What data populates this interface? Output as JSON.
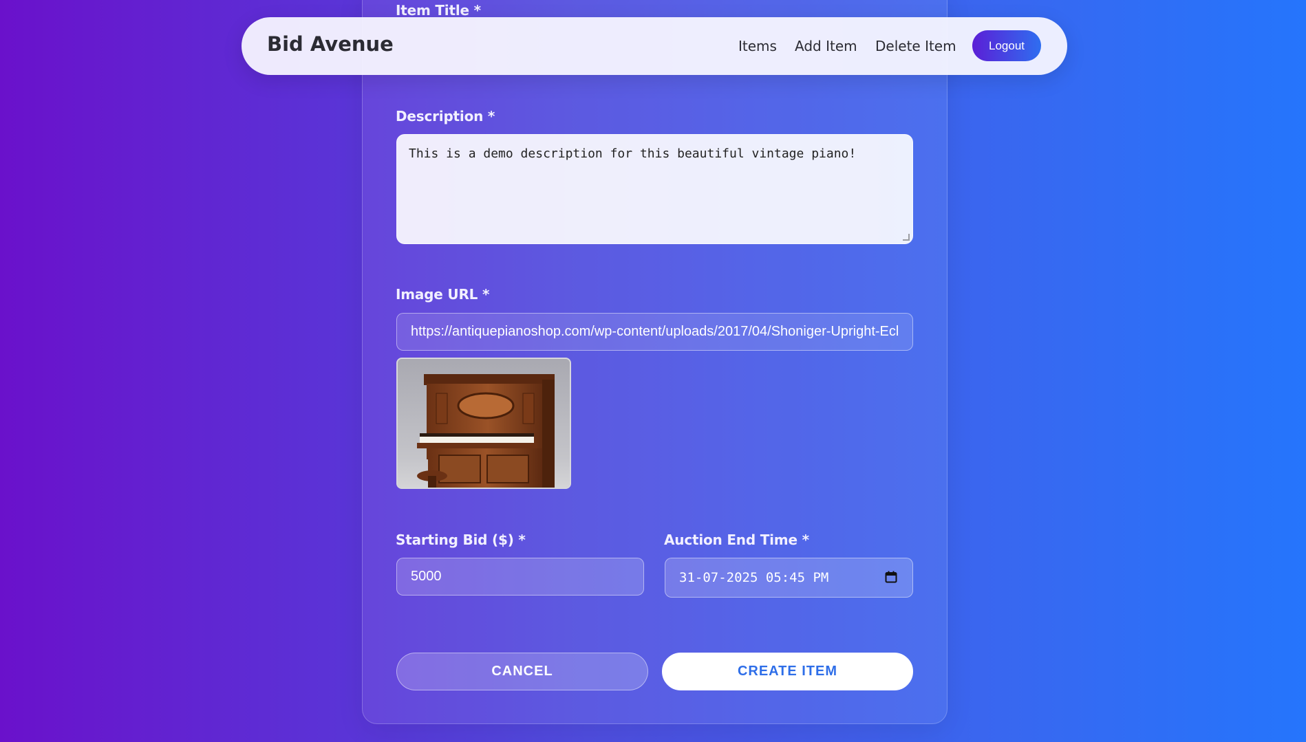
{
  "navbar": {
    "brand": "Bid Avenue",
    "links": [
      "Items",
      "Add Item",
      "Delete Item"
    ],
    "logout_label": "Logout"
  },
  "form": {
    "title_label": "Item Title *",
    "description_label": "Description *",
    "description_value": "This is a demo description for this beautiful vintage piano!",
    "image_url_label": "Image URL *",
    "image_url_value": "https://antiquepianoshop.com/wp-content/uploads/2017/04/Shoniger-Upright-Ecl",
    "starting_bid_label": "Starting Bid ($) *",
    "starting_bid_value": "5000",
    "end_time_label": "Auction End Time *",
    "end_time_value": "31-07-2025 05:45 PM",
    "cancel_label": "CANCEL",
    "create_label": "CREATE ITEM"
  },
  "colors": {
    "gradient_start": "#6a11cb",
    "gradient_end": "#2575fc",
    "create_text": "#2e6ee8"
  }
}
